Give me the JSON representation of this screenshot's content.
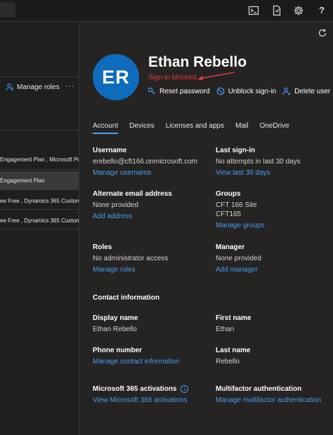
{
  "topbar": {
    "icons": [
      "terminal-icon",
      "feedback-icon",
      "settings-gear-icon",
      "help-icon"
    ],
    "help_label": "?"
  },
  "left": {
    "manage_roles": "Manage roles",
    "more": "···",
    "rows": [
      "Engagement Plan , Microsoft Po",
      "Engagement Plan",
      "ee Free , Dynamics 365 Custome",
      "ee Free , Dynamics 365 Custome"
    ]
  },
  "panel": {
    "avatar_initials": "ER",
    "name": "Ethan Rebello",
    "status": "Sign-in blocked",
    "actions": {
      "reset_password": "Reset password",
      "unblock_signin": "Unblock sign-in",
      "delete_user": "Delete user"
    },
    "tabs": [
      "Account",
      "Devices",
      "Licenses and apps",
      "Mail",
      "OneDrive"
    ],
    "active_tab": "Account",
    "username": {
      "label": "Username",
      "value": "erebello@cft166.onmicrosoft.com",
      "link": "Manage username"
    },
    "last_signin": {
      "label": "Last sign-in",
      "value": "No attempts in last 30 days",
      "link": "View last 30 days"
    },
    "alt_email": {
      "label": "Alternate email address",
      "value": "None provided",
      "link": "Add address"
    },
    "groups": {
      "label": "Groups",
      "value1": "CFT 166 Site",
      "value2": "CFT165",
      "link": "Manage groups"
    },
    "roles": {
      "label": "Roles",
      "value": "No administrator access",
      "link": "Manage roles"
    },
    "manager": {
      "label": "Manager",
      "value": "None provided",
      "link": "Add manager"
    },
    "contact_title": "Contact information",
    "display_name": {
      "label": "Display name",
      "value": "Ethan Rebello"
    },
    "first_name": {
      "label": "First name",
      "value": "Ethan"
    },
    "phone": {
      "label": "Phone number",
      "link": "Manage contact information"
    },
    "last_name": {
      "label": "Last name",
      "value": "Rebello"
    },
    "m365": {
      "label": "Microsoft 365 activations",
      "info": "i",
      "link": "View Microsoft 365 activations"
    },
    "mfa": {
      "label": "Multifactor authentication",
      "link": "Manage multifactor authentication"
    }
  },
  "colors": {
    "accent": "#479ef5",
    "avatar": "#0f6cbd",
    "blocked": "#e23b3b",
    "panel_bg": "#252423"
  }
}
